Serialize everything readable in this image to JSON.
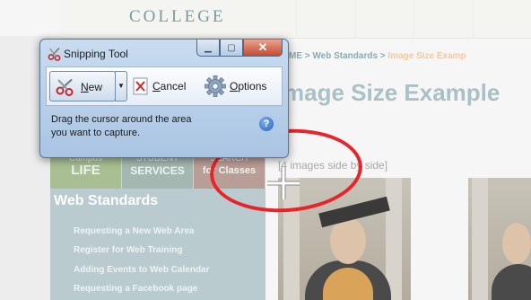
{
  "site": {
    "college_label": "COLLEGE",
    "breadcrumb": {
      "prefix": "ME > Web Standards > ",
      "current": "Image Size Examp"
    },
    "page_title": "mage Size Example",
    "subnote": "[4 images side by side]",
    "sidebar": {
      "tabs": [
        {
          "top": "Campus",
          "main": "LIFE"
        },
        {
          "top": "STUDENT",
          "main": "SERVICES"
        },
        {
          "top": "SEARCH",
          "main": "for Classes"
        }
      ],
      "heading": "Web Standards",
      "links": [
        "Requesting a New Web Area",
        "Register for Web Training",
        "Adding Events to Web Calendar",
        "Requesting a Facebook page"
      ]
    }
  },
  "snipping_tool": {
    "title": "Snipping Tool",
    "new_label_accel": "N",
    "new_label_rest": "ew",
    "cancel_label_accel": "C",
    "cancel_label_rest": "ancel",
    "options_label_accel": "O",
    "options_label_rest": "ptions",
    "hint_line1": "Drag the cursor around the area",
    "hint_line2": "you want to capture.",
    "help_glyph": "?"
  },
  "colors": {
    "annotation_ellipse": "#e8242a",
    "window_frame": "#a9c4e2"
  },
  "icons": {
    "app": "scissors-icon",
    "new": "scissors-icon",
    "cancel": "close-icon",
    "options": "gear-icon",
    "help": "help-icon",
    "cursor": "crosshair-icon"
  }
}
